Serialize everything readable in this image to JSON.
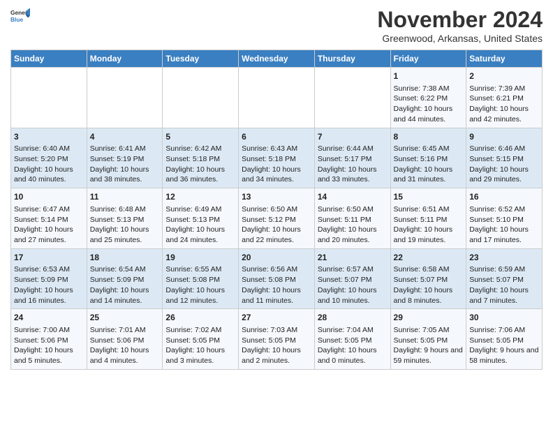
{
  "header": {
    "logo_general": "General",
    "logo_blue": "Blue",
    "month_title": "November 2024",
    "location": "Greenwood, Arkansas, United States"
  },
  "weekdays": [
    "Sunday",
    "Monday",
    "Tuesday",
    "Wednesday",
    "Thursday",
    "Friday",
    "Saturday"
  ],
  "weeks": [
    [
      {
        "day": "",
        "content": ""
      },
      {
        "day": "",
        "content": ""
      },
      {
        "day": "",
        "content": ""
      },
      {
        "day": "",
        "content": ""
      },
      {
        "day": "",
        "content": ""
      },
      {
        "day": "1",
        "content": "Sunrise: 7:38 AM\nSunset: 6:22 PM\nDaylight: 10 hours and 44 minutes."
      },
      {
        "day": "2",
        "content": "Sunrise: 7:39 AM\nSunset: 6:21 PM\nDaylight: 10 hours and 42 minutes."
      }
    ],
    [
      {
        "day": "3",
        "content": "Sunrise: 6:40 AM\nSunset: 5:20 PM\nDaylight: 10 hours and 40 minutes."
      },
      {
        "day": "4",
        "content": "Sunrise: 6:41 AM\nSunset: 5:19 PM\nDaylight: 10 hours and 38 minutes."
      },
      {
        "day": "5",
        "content": "Sunrise: 6:42 AM\nSunset: 5:18 PM\nDaylight: 10 hours and 36 minutes."
      },
      {
        "day": "6",
        "content": "Sunrise: 6:43 AM\nSunset: 5:18 PM\nDaylight: 10 hours and 34 minutes."
      },
      {
        "day": "7",
        "content": "Sunrise: 6:44 AM\nSunset: 5:17 PM\nDaylight: 10 hours and 33 minutes."
      },
      {
        "day": "8",
        "content": "Sunrise: 6:45 AM\nSunset: 5:16 PM\nDaylight: 10 hours and 31 minutes."
      },
      {
        "day": "9",
        "content": "Sunrise: 6:46 AM\nSunset: 5:15 PM\nDaylight: 10 hours and 29 minutes."
      }
    ],
    [
      {
        "day": "10",
        "content": "Sunrise: 6:47 AM\nSunset: 5:14 PM\nDaylight: 10 hours and 27 minutes."
      },
      {
        "day": "11",
        "content": "Sunrise: 6:48 AM\nSunset: 5:13 PM\nDaylight: 10 hours and 25 minutes."
      },
      {
        "day": "12",
        "content": "Sunrise: 6:49 AM\nSunset: 5:13 PM\nDaylight: 10 hours and 24 minutes."
      },
      {
        "day": "13",
        "content": "Sunrise: 6:50 AM\nSunset: 5:12 PM\nDaylight: 10 hours and 22 minutes."
      },
      {
        "day": "14",
        "content": "Sunrise: 6:50 AM\nSunset: 5:11 PM\nDaylight: 10 hours and 20 minutes."
      },
      {
        "day": "15",
        "content": "Sunrise: 6:51 AM\nSunset: 5:11 PM\nDaylight: 10 hours and 19 minutes."
      },
      {
        "day": "16",
        "content": "Sunrise: 6:52 AM\nSunset: 5:10 PM\nDaylight: 10 hours and 17 minutes."
      }
    ],
    [
      {
        "day": "17",
        "content": "Sunrise: 6:53 AM\nSunset: 5:09 PM\nDaylight: 10 hours and 16 minutes."
      },
      {
        "day": "18",
        "content": "Sunrise: 6:54 AM\nSunset: 5:09 PM\nDaylight: 10 hours and 14 minutes."
      },
      {
        "day": "19",
        "content": "Sunrise: 6:55 AM\nSunset: 5:08 PM\nDaylight: 10 hours and 12 minutes."
      },
      {
        "day": "20",
        "content": "Sunrise: 6:56 AM\nSunset: 5:08 PM\nDaylight: 10 hours and 11 minutes."
      },
      {
        "day": "21",
        "content": "Sunrise: 6:57 AM\nSunset: 5:07 PM\nDaylight: 10 hours and 10 minutes."
      },
      {
        "day": "22",
        "content": "Sunrise: 6:58 AM\nSunset: 5:07 PM\nDaylight: 10 hours and 8 minutes."
      },
      {
        "day": "23",
        "content": "Sunrise: 6:59 AM\nSunset: 5:07 PM\nDaylight: 10 hours and 7 minutes."
      }
    ],
    [
      {
        "day": "24",
        "content": "Sunrise: 7:00 AM\nSunset: 5:06 PM\nDaylight: 10 hours and 5 minutes."
      },
      {
        "day": "25",
        "content": "Sunrise: 7:01 AM\nSunset: 5:06 PM\nDaylight: 10 hours and 4 minutes."
      },
      {
        "day": "26",
        "content": "Sunrise: 7:02 AM\nSunset: 5:05 PM\nDaylight: 10 hours and 3 minutes."
      },
      {
        "day": "27",
        "content": "Sunrise: 7:03 AM\nSunset: 5:05 PM\nDaylight: 10 hours and 2 minutes."
      },
      {
        "day": "28",
        "content": "Sunrise: 7:04 AM\nSunset: 5:05 PM\nDaylight: 10 hours and 0 minutes."
      },
      {
        "day": "29",
        "content": "Sunrise: 7:05 AM\nSunset: 5:05 PM\nDaylight: 9 hours and 59 minutes."
      },
      {
        "day": "30",
        "content": "Sunrise: 7:06 AM\nSunset: 5:05 PM\nDaylight: 9 hours and 58 minutes."
      }
    ]
  ]
}
